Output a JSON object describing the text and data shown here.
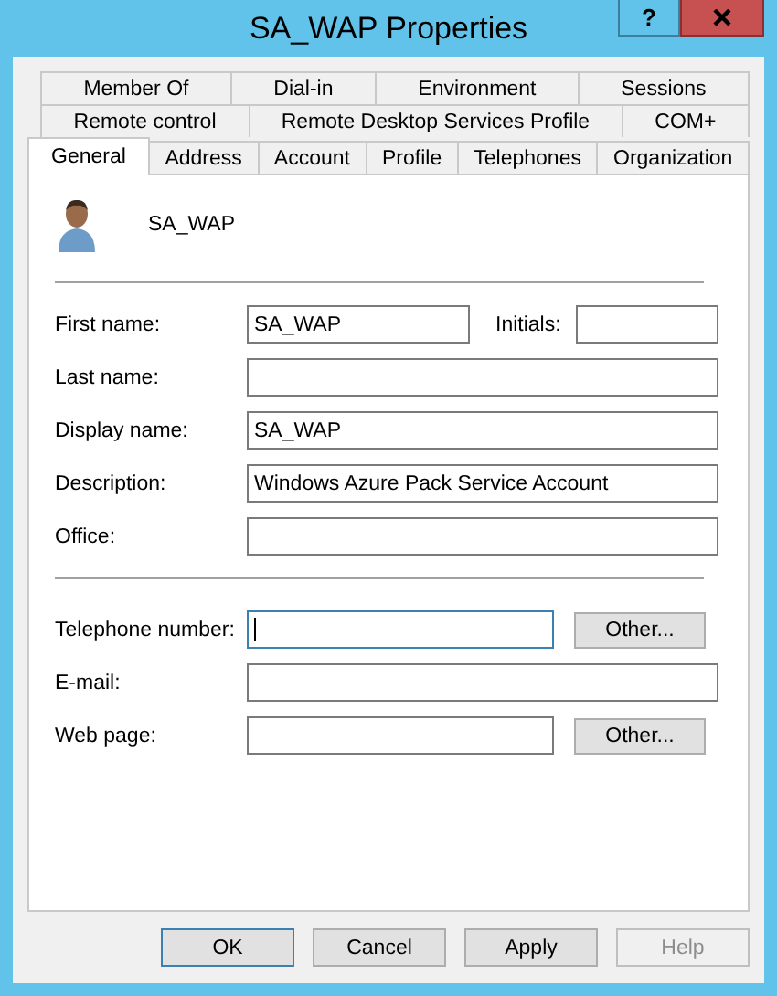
{
  "window": {
    "title": "SA_WAP Properties",
    "help_button": "?"
  },
  "tab_rows": [
    [
      {
        "label": "Member Of",
        "selected": false
      },
      {
        "label": "Dial-in",
        "selected": false
      },
      {
        "label": "Environment",
        "selected": false
      },
      {
        "label": "Sessions",
        "selected": false
      }
    ],
    [
      {
        "label": "Remote control",
        "selected": false
      },
      {
        "label": "Remote Desktop Services Profile",
        "selected": false
      },
      {
        "label": "COM+",
        "selected": false
      }
    ],
    [
      {
        "label": "General",
        "selected": true
      },
      {
        "label": "Address",
        "selected": false
      },
      {
        "label": "Account",
        "selected": false
      },
      {
        "label": "Profile",
        "selected": false
      },
      {
        "label": "Telephones",
        "selected": false
      },
      {
        "label": "Organization",
        "selected": false
      }
    ]
  ],
  "account_name": "SA_WAP",
  "field_groups": [
    [
      {
        "label": "First name:",
        "value": "SA_WAP",
        "focused": false,
        "extra_label": "Initials:"
      },
      {
        "label": "Last name:",
        "focused": false
      },
      {
        "label": "Display name:",
        "value": "SA_WAP",
        "focused": false
      },
      {
        "label": "Description:",
        "value": "Windows Azure Pack Service Account",
        "focused": false
      },
      {
        "label": "Office:",
        "focused": false
      }
    ],
    [
      {
        "label": "Telephone number:",
        "focused": true,
        "button": "Other..."
      },
      {
        "label": "E-mail:",
        "focused": false
      },
      {
        "label": "Web page:",
        "focused": false,
        "button": "Other..."
      }
    ]
  ],
  "buttons": [
    {
      "label": "OK",
      "default": true,
      "disabled": false
    },
    {
      "label": "Cancel",
      "default": false,
      "disabled": false
    },
    {
      "label": "Apply",
      "default": false,
      "disabled": false
    },
    {
      "label": "Help",
      "default": false,
      "disabled": true
    }
  ]
}
